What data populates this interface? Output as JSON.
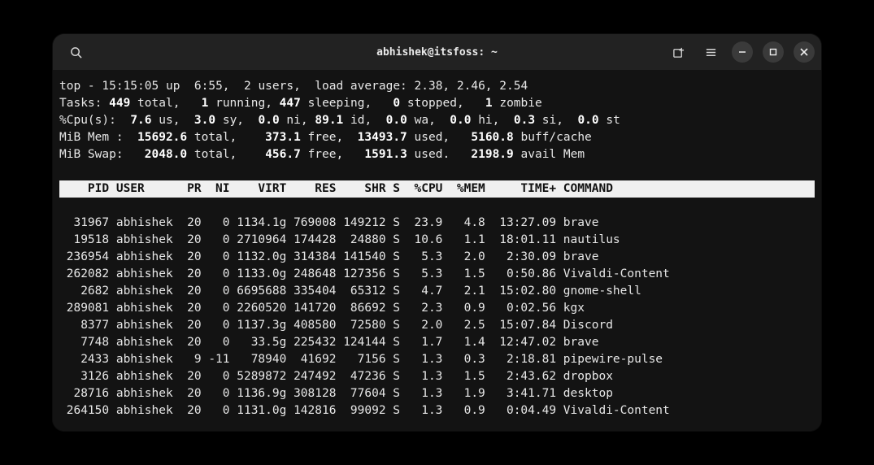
{
  "window": {
    "title": "abhishek@itsfoss: ~"
  },
  "top": {
    "line1": {
      "prefix": "top - ",
      "time": "15:15:05",
      "up": " up  6:55,  2 users,  load average: 2.38, 2.46, 2.54"
    },
    "tasks": {
      "label": "Tasks: ",
      "total": "449",
      "running": "1",
      "sleeping": "447",
      "stopped": "0",
      "zombie": "1"
    },
    "cpu": {
      "label": "%Cpu(s):  ",
      "us": "7.6",
      "sy": "3.0",
      "ni": "0.0",
      "id": "89.1",
      "wa": "0.0",
      "hi": "0.0",
      "si": "0.3",
      "st": "0.0"
    },
    "mem": {
      "label": "MiB Mem :  ",
      "total": "15692.6",
      "free": "373.1",
      "used": "13493.7",
      "buff": "5160.8"
    },
    "swap": {
      "label": "MiB Swap:   ",
      "total": "2048.0",
      "free": "456.7",
      "used": "1591.3",
      "avail": "2198.9"
    }
  },
  "columns": "    PID USER      PR  NI    VIRT    RES    SHR S  %CPU  %MEM     TIME+ COMMAND                   ",
  "processes": [
    {
      "pid": "31967",
      "user": "abhishek",
      "pr": "20",
      "ni": "0",
      "virt": "1134.1g",
      "res": "769008",
      "shr": "149212",
      "s": "S",
      "cpu": "23.9",
      "mem": "4.8",
      "time": "13:27.09",
      "cmd": "brave"
    },
    {
      "pid": "19518",
      "user": "abhishek",
      "pr": "20",
      "ni": "0",
      "virt": "2710964",
      "res": "174428",
      "shr": "24880",
      "s": "S",
      "cpu": "10.6",
      "mem": "1.1",
      "time": "18:01.11",
      "cmd": "nautilus"
    },
    {
      "pid": "236954",
      "user": "abhishek",
      "pr": "20",
      "ni": "0",
      "virt": "1132.0g",
      "res": "314384",
      "shr": "141540",
      "s": "S",
      "cpu": "5.3",
      "mem": "2.0",
      "time": "2:30.09",
      "cmd": "brave"
    },
    {
      "pid": "262082",
      "user": "abhishek",
      "pr": "20",
      "ni": "0",
      "virt": "1133.0g",
      "res": "248648",
      "shr": "127356",
      "s": "S",
      "cpu": "5.3",
      "mem": "1.5",
      "time": "0:50.86",
      "cmd": "Vivaldi-Content"
    },
    {
      "pid": "2682",
      "user": "abhishek",
      "pr": "20",
      "ni": "0",
      "virt": "6695688",
      "res": "335404",
      "shr": "65312",
      "s": "S",
      "cpu": "4.7",
      "mem": "2.1",
      "time": "15:02.80",
      "cmd": "gnome-shell"
    },
    {
      "pid": "289081",
      "user": "abhishek",
      "pr": "20",
      "ni": "0",
      "virt": "2260520",
      "res": "141720",
      "shr": "86692",
      "s": "S",
      "cpu": "2.3",
      "mem": "0.9",
      "time": "0:02.56",
      "cmd": "kgx"
    },
    {
      "pid": "8377",
      "user": "abhishek",
      "pr": "20",
      "ni": "0",
      "virt": "1137.3g",
      "res": "408580",
      "shr": "72580",
      "s": "S",
      "cpu": "2.0",
      "mem": "2.5",
      "time": "15:07.84",
      "cmd": "Discord"
    },
    {
      "pid": "7748",
      "user": "abhishek",
      "pr": "20",
      "ni": "0",
      "virt": "33.5g",
      "res": "225432",
      "shr": "124144",
      "s": "S",
      "cpu": "1.7",
      "mem": "1.4",
      "time": "12:47.02",
      "cmd": "brave"
    },
    {
      "pid": "2433",
      "user": "abhishek",
      "pr": "9",
      "ni": "-11",
      "virt": "78940",
      "res": "41692",
      "shr": "7156",
      "s": "S",
      "cpu": "1.3",
      "mem": "0.3",
      "time": "2:18.81",
      "cmd": "pipewire-pulse"
    },
    {
      "pid": "3126",
      "user": "abhishek",
      "pr": "20",
      "ni": "0",
      "virt": "5289872",
      "res": "247492",
      "shr": "47236",
      "s": "S",
      "cpu": "1.3",
      "mem": "1.5",
      "time": "2:43.62",
      "cmd": "dropbox"
    },
    {
      "pid": "28716",
      "user": "abhishek",
      "pr": "20",
      "ni": "0",
      "virt": "1136.9g",
      "res": "308128",
      "shr": "77604",
      "s": "S",
      "cpu": "1.3",
      "mem": "1.9",
      "time": "3:41.71",
      "cmd": "desktop"
    },
    {
      "pid": "264150",
      "user": "abhishek",
      "pr": "20",
      "ni": "0",
      "virt": "1131.0g",
      "res": "142816",
      "shr": "99092",
      "s": "S",
      "cpu": "1.3",
      "mem": "0.9",
      "time": "0:04.49",
      "cmd": "Vivaldi-Content"
    }
  ]
}
